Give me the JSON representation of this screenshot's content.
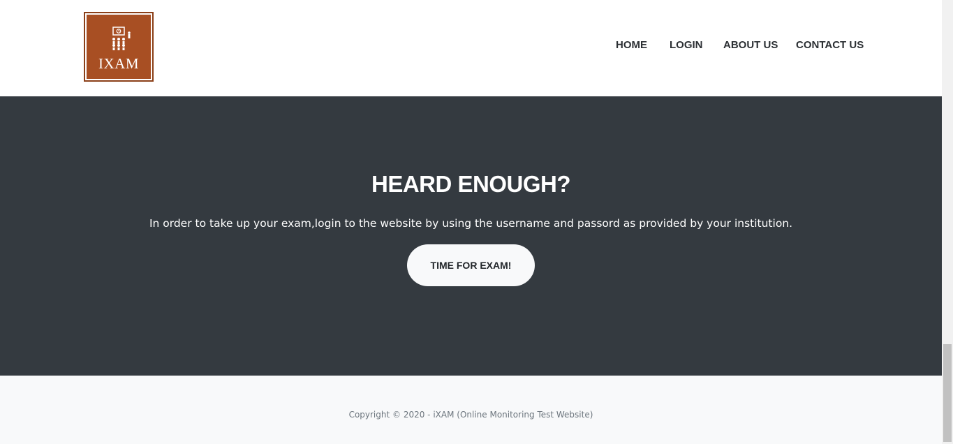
{
  "header": {
    "logo_text": "IXAM",
    "nav": [
      {
        "label": "HOME"
      },
      {
        "label": "LOGIN"
      },
      {
        "label": "ABOUT US"
      },
      {
        "label": "CONTACT US"
      }
    ]
  },
  "hero": {
    "title": "HEARD ENOUGH?",
    "text": "In order to take up your exam,login to the website by using the username and passord as provided by your institution.",
    "button_label": "TIME FOR EXAM!"
  },
  "footer": {
    "copyright": "Copyright © 2020 - iXAM (Online Monitoring Test Website)"
  },
  "colors": {
    "brand": "#a84f23",
    "hero_bg": "#343a40",
    "footer_bg": "#f8f9fa"
  }
}
